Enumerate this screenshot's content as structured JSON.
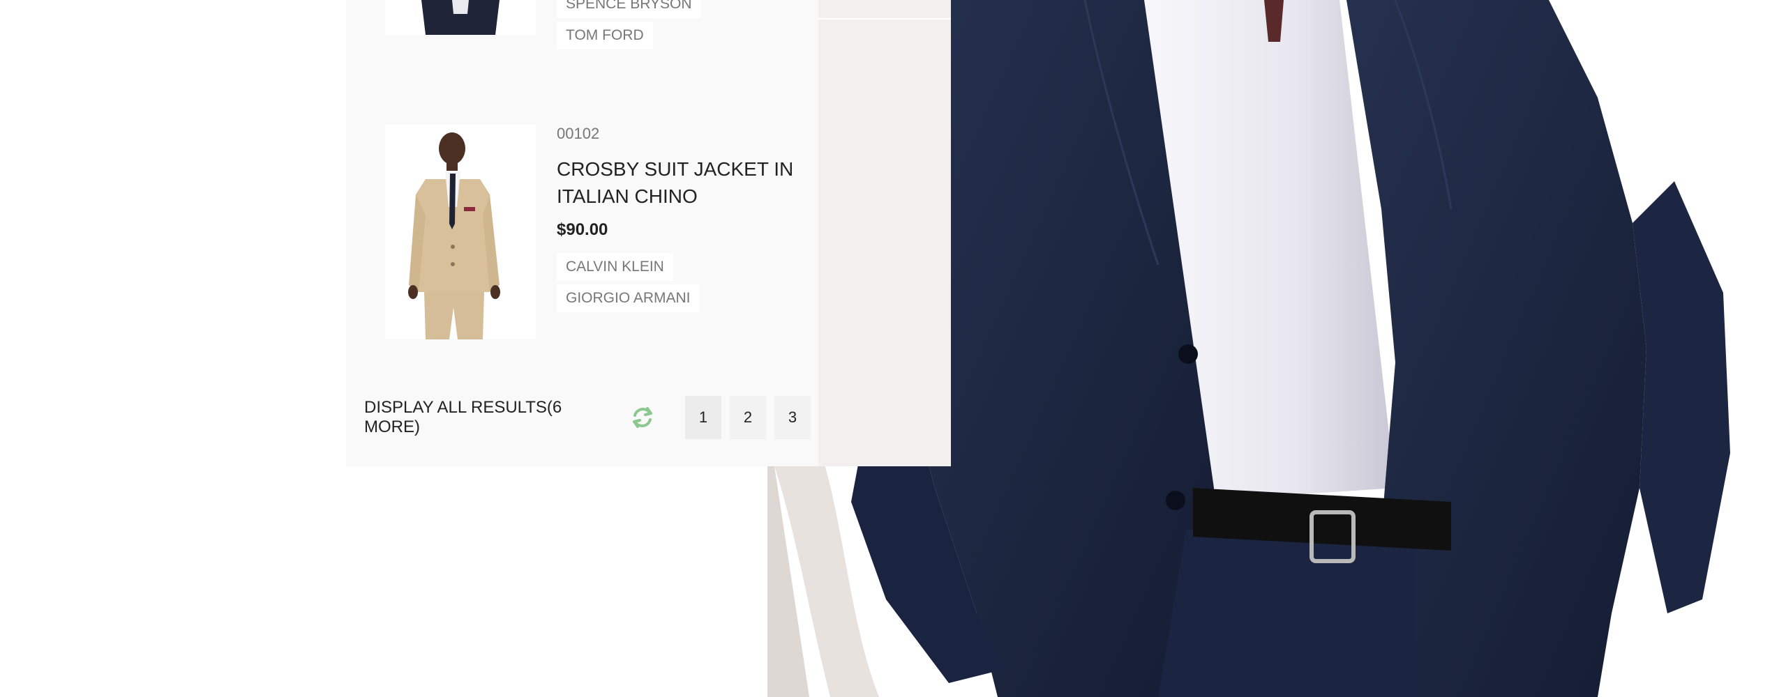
{
  "results": {
    "previous_item": {
      "brands": [
        "SPENCE BRYSON",
        "TOM FORD"
      ]
    },
    "item": {
      "sku": "00102",
      "name": "CROSBY SUIT JACKET IN ITALIAN CHINO",
      "price": "$90.00",
      "brands": [
        "CALVIN KLEIN",
        "GIORGIO ARMANI"
      ]
    },
    "footer": {
      "display_all": "DISPLAY ALL RESULTS(6 MORE)",
      "refresh_icon": "refresh-icon",
      "pages": [
        "1",
        "2",
        "3"
      ],
      "current_page": "1"
    }
  },
  "colors": {
    "accent_green": "#8bc88f",
    "suit_navy": "#1f2a45",
    "panel_bg": "#f9f9f9"
  }
}
